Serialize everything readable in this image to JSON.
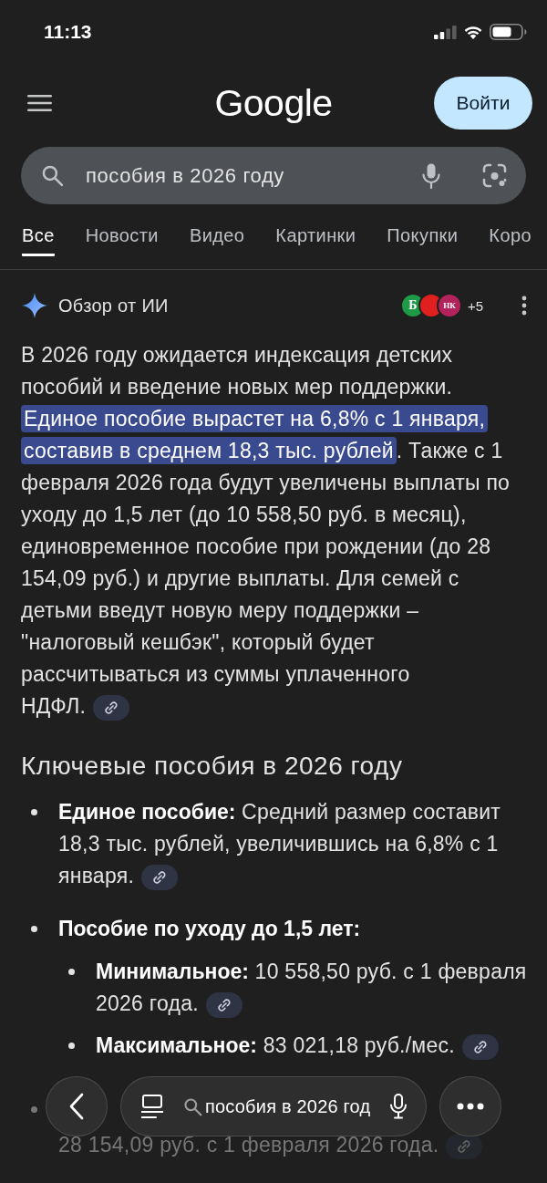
{
  "status_bar": {
    "time": "11:13"
  },
  "header": {
    "logo": "Google",
    "sign_in_button": "Войти"
  },
  "search": {
    "value": "пособия в 2026 году"
  },
  "tabs": [
    {
      "label": "Все",
      "selected": true
    },
    {
      "label": "Новости",
      "selected": false
    },
    {
      "label": "Видео",
      "selected": false
    },
    {
      "label": "Картинки",
      "selected": false
    },
    {
      "label": "Покупки",
      "selected": false
    },
    {
      "label": "Коро",
      "selected": false
    }
  ],
  "ai_overview": {
    "title": "Обзор от ИИ",
    "sources": [
      {
        "label": "Б",
        "color": "#1f9a46"
      },
      {
        "color": "#e0201e"
      },
      {
        "label": "НК",
        "color": "#b2235b"
      }
    ],
    "more_sources": "+5",
    "summary": [
      {
        "text": "В 2026 году ожидается индексация детских пособий и введение новых мер поддержки. ",
        "highlighted": false,
        "link": false
      },
      {
        "text": "Единое пособие вырастет на 6,8% с 1 января, составив в среднем 18,3 тыс. рублей",
        "highlighted": true,
        "link": false
      },
      {
        "text": ". Также с 1 февраля 2026 года будут увеличены выплаты по уходу до 1,5 лет (до 10 558,50 руб. в месяц), единовременное пособие при рождении (до 28 154,09 руб.) и другие выплаты. Для семей с детьми введут новую меру поддержки – \"налоговый кешбэк\", который будет рассчитываться из суммы уплаченного НДФЛ.",
        "highlighted": false,
        "link": true
      }
    ],
    "heading": "Ключевые пособия в 2026 году",
    "items": [
      {
        "kind": "item",
        "text": "**Единое пособие:** Средний размер составит 18,3 тыс. рублей, увеличившись на 6,8% с 1 января.",
        "link": true
      },
      {
        "kind": "item",
        "text": "**Пособие по уходу до 1,5 лет:**",
        "link": false,
        "children": [
          {
            "kind": "item",
            "text": "**Минимальное:** 10 558,50 руб. с 1 февраля 2026 года.",
            "link": true
          },
          {
            "kind": "item",
            "text": "**Максимальное:** 83 021,18 руб./мес.",
            "link": true
          }
        ]
      },
      {
        "kind": "faded",
        "text": "28 154,09 руб. с 1 февраля 2026 года.",
        "link": true
      }
    ]
  },
  "bottom_bar": {
    "query": "пособия в 2026 год"
  }
}
